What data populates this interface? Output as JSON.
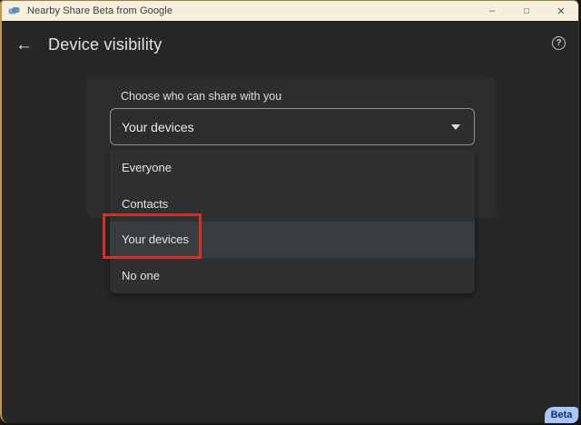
{
  "titlebar": {
    "title": "Nearby Share Beta from Google",
    "minimize_glyph": "–",
    "maximize_glyph": "□",
    "close_glyph": "✕"
  },
  "header": {
    "back_glyph": "←",
    "title": "Device visibility",
    "help_glyph": "?"
  },
  "main": {
    "field_label": "Choose who can share with you",
    "select_value": "Your devices",
    "menu_items": [
      {
        "label": "Everyone",
        "selected": false,
        "annotated": false
      },
      {
        "label": "Contacts",
        "selected": false,
        "annotated": false
      },
      {
        "label": "Your devices",
        "selected": true,
        "annotated": true
      },
      {
        "label": "No one",
        "selected": false,
        "annotated": false
      }
    ]
  },
  "footer": {
    "beta_label": "Beta"
  },
  "colors": {
    "titlebar_bg": "#f6efde",
    "accent_border": "#c49545",
    "content_bg": "#272727",
    "card_bg": "#2d2d2d",
    "menu_bg": "#2e3032",
    "menu_selected_bg": "#3a3d3f",
    "annotation_red": "#d62f2a",
    "beta_badge_bg": "#a8c7fa",
    "beta_badge_text": "#10305e"
  }
}
